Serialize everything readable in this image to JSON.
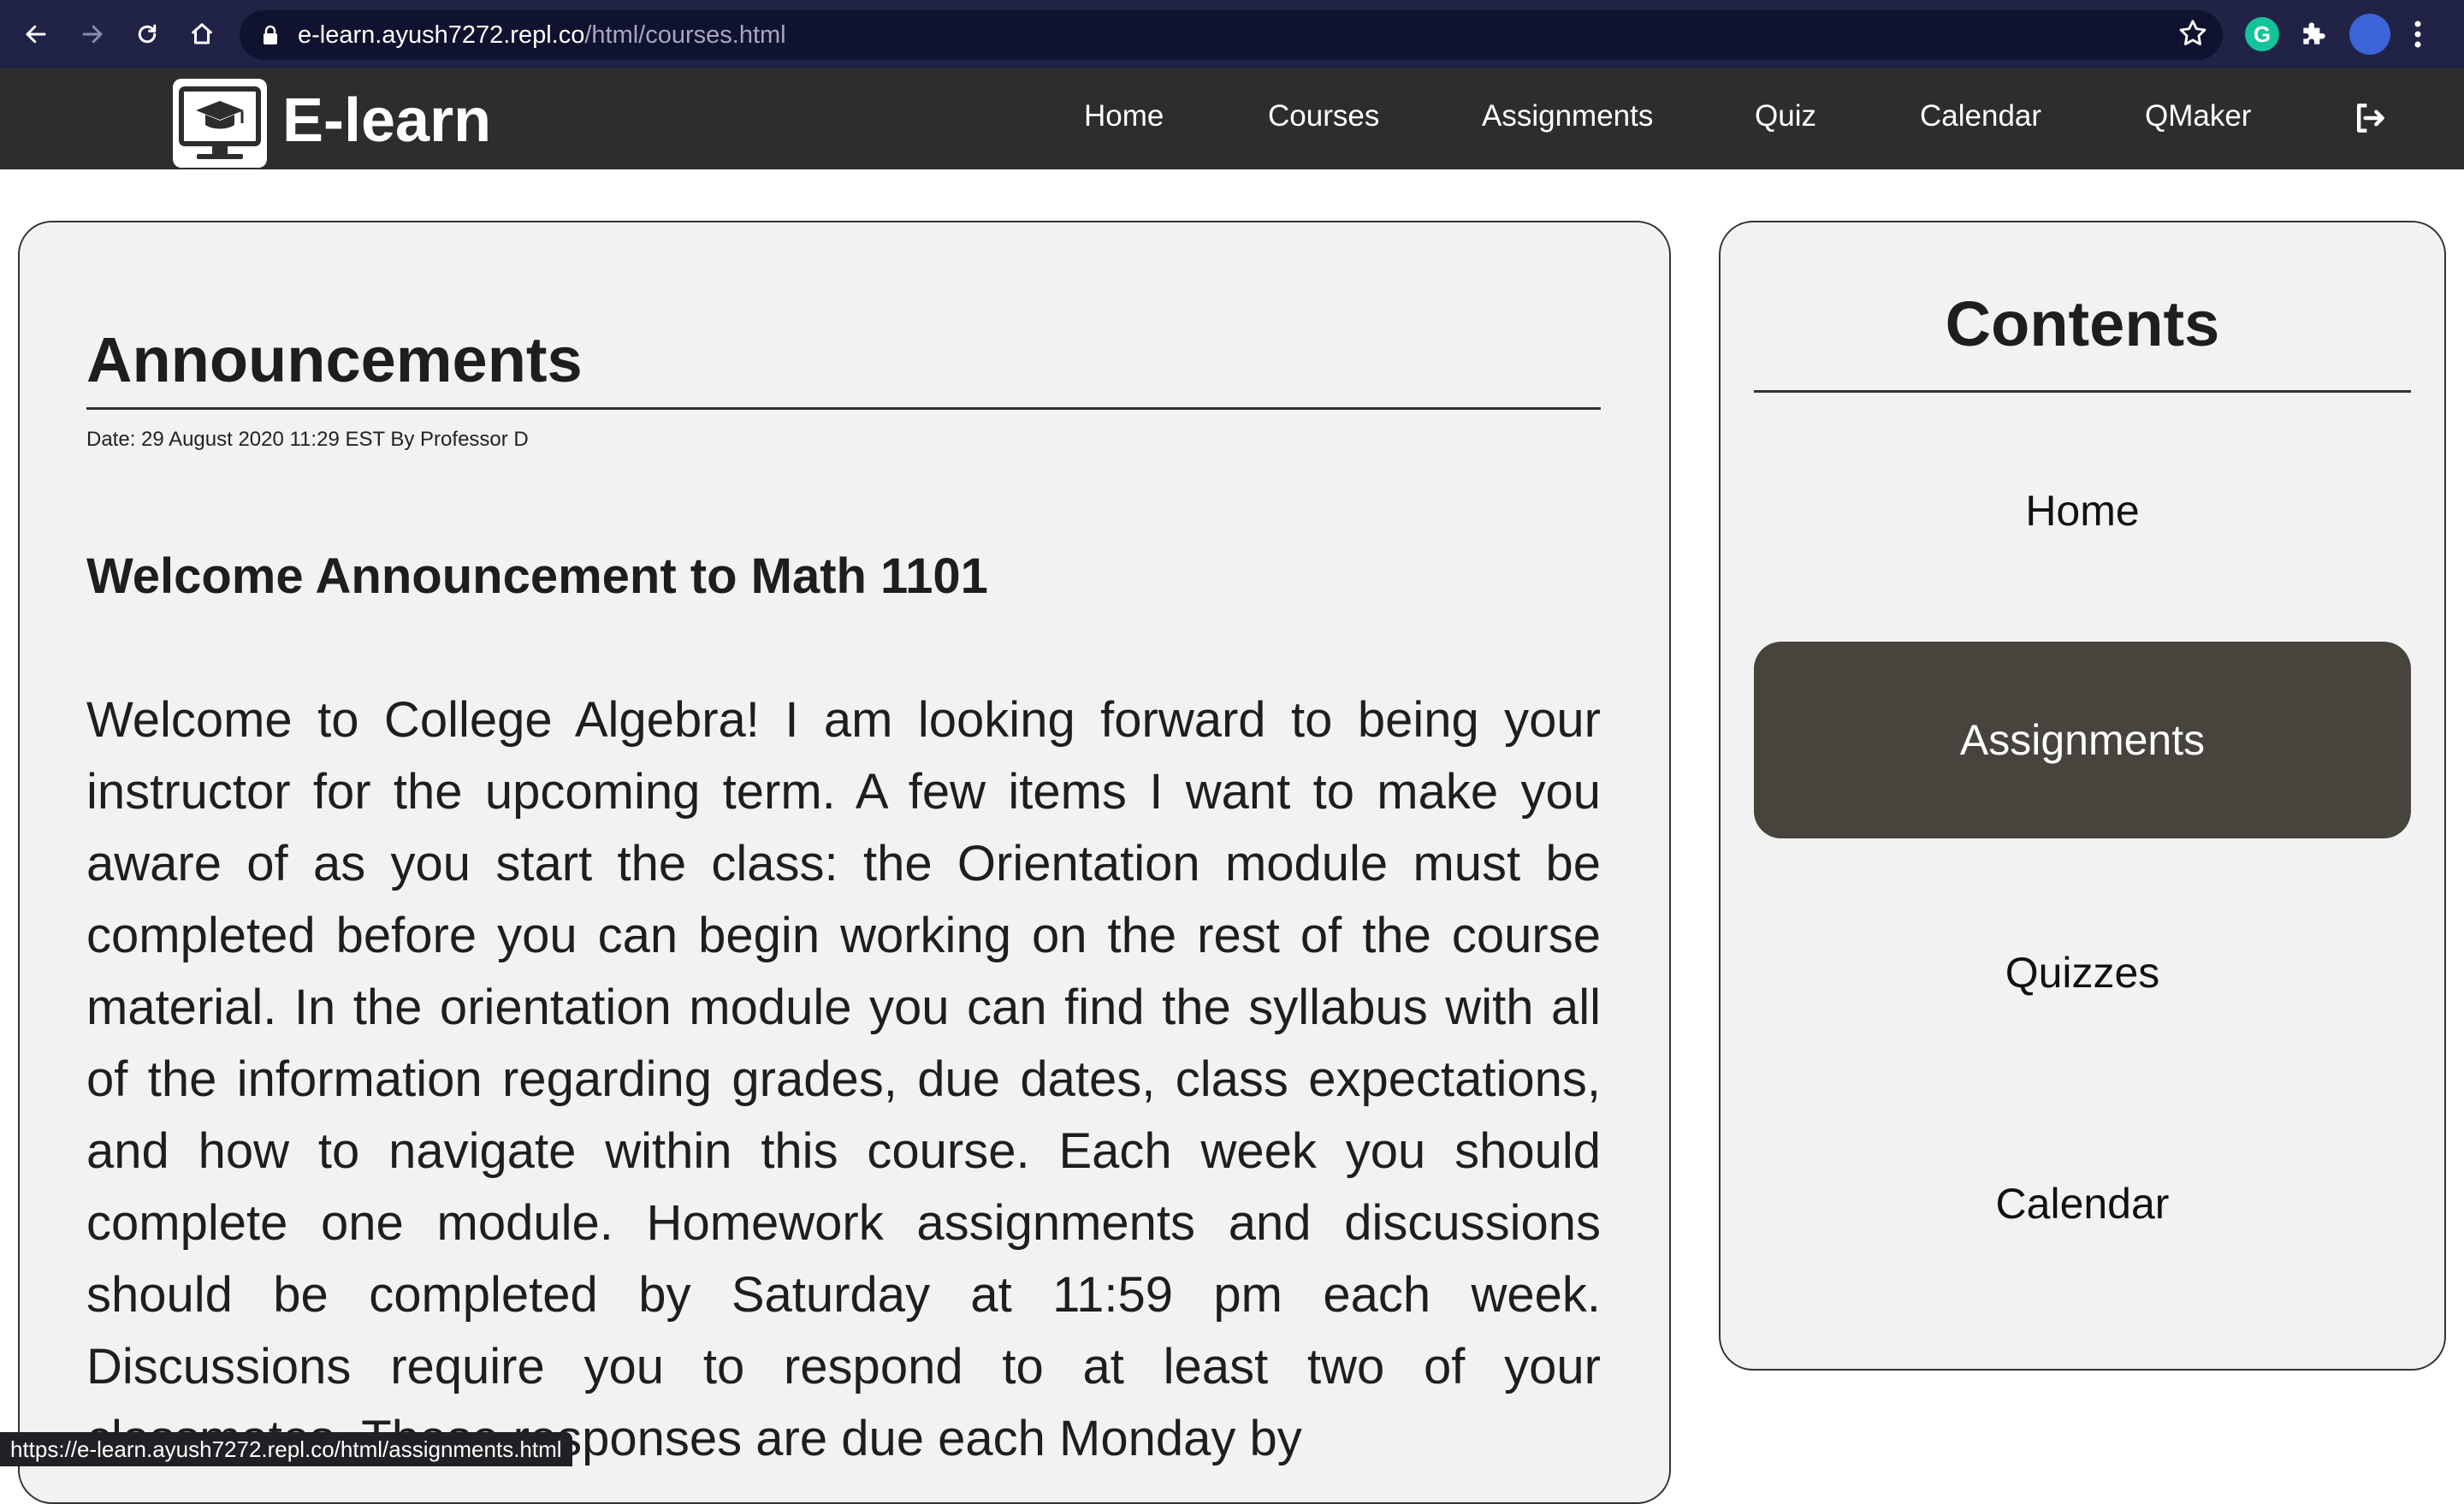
{
  "browser": {
    "url_host": "e-learn.ayush7272.repl.co",
    "url_path": "/html/courses.html",
    "extension_letter": "G",
    "status_url": "https://e-learn.ayush7272.repl.co/html/assignments.html"
  },
  "brand": {
    "name": "E-learn"
  },
  "nav": {
    "items": [
      {
        "label": "Home"
      },
      {
        "label": "Courses"
      },
      {
        "label": "Assignments"
      },
      {
        "label": "Quiz"
      },
      {
        "label": "Calendar"
      },
      {
        "label": "QMaker"
      }
    ]
  },
  "announcement": {
    "section_title": "Announcements",
    "meta": "Date: 29 August 2020 11:29 EST By Professor D",
    "heading": "Welcome Announcement to Math 1101",
    "body": "Welcome to College Algebra! I am looking forward to being your instructor for the upcoming term. A few items I want to make you aware of as you start the class: the Orientation module must be completed before you can begin working on the rest of the course material. In the orientation module you can find the syllabus with all of the information regarding grades, due dates, class expectations, and how to navigate within this course. Each week you should complete one module. Homework assignments and discussions should be completed by Saturday at 11:59 pm each week. Discussions require you to respond to at least two of your classmates. These responses are due each Monday by"
  },
  "contents": {
    "title": "Contents",
    "items": [
      {
        "label": "Home",
        "active": false
      },
      {
        "label": "Assignments",
        "active": true
      },
      {
        "label": "Quizzes",
        "active": false
      },
      {
        "label": "Calendar",
        "active": false
      }
    ]
  },
  "colors": {
    "chrome_bg": "#202346",
    "navbar_bg": "#2d2d2d",
    "card_bg": "#f2f2f2",
    "active_item_bg": "#46443c"
  }
}
